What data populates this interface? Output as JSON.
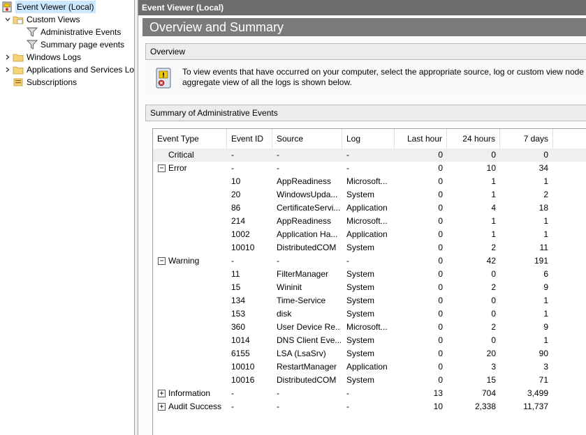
{
  "tree": {
    "root": "Event Viewer (Local)",
    "custom_views": "Custom Views",
    "administrative_events": "Administrative Events",
    "summary_page_events": "Summary page events",
    "windows_logs": "Windows Logs",
    "applications_and_services": "Applications and Services Lo",
    "subscriptions": "Subscriptions"
  },
  "header": {
    "title": "Event Viewer (Local)",
    "page_title": "Overview and Summary"
  },
  "overview": {
    "heading": "Overview",
    "line1": "To view events that have occurred on your computer, select the appropriate source, log or custom view node i",
    "line2": "aggregate view of all the logs is shown below."
  },
  "summary": {
    "heading": "Summary of Administrative Events",
    "columns": [
      "Event Type",
      "Event ID",
      "Source",
      "Log",
      "Last hour",
      "24 hours",
      "7 days"
    ],
    "rows": [
      {
        "type": "Critical",
        "expander": "",
        "id": "-",
        "source": "-",
        "log": "-",
        "hour": "0",
        "day": "0",
        "week": "0",
        "group": true,
        "shaded": true
      },
      {
        "type": "Error",
        "expander": "−",
        "id": "-",
        "source": "-",
        "log": "-",
        "hour": "0",
        "day": "10",
        "week": "34",
        "group": true
      },
      {
        "type": "",
        "expander": "",
        "id": "10",
        "source": "AppReadiness",
        "log": "Microsoft...",
        "hour": "0",
        "day": "1",
        "week": "1"
      },
      {
        "type": "",
        "expander": "",
        "id": "20",
        "source": "WindowsUpda...",
        "log": "System",
        "hour": "0",
        "day": "1",
        "week": "2"
      },
      {
        "type": "",
        "expander": "",
        "id": "86",
        "source": "CertificateServi...",
        "log": "Application",
        "hour": "0",
        "day": "4",
        "week": "18"
      },
      {
        "type": "",
        "expander": "",
        "id": "214",
        "source": "AppReadiness",
        "log": "Microsoft...",
        "hour": "0",
        "day": "1",
        "week": "1"
      },
      {
        "type": "",
        "expander": "",
        "id": "1002",
        "source": "Application Ha...",
        "log": "Application",
        "hour": "0",
        "day": "1",
        "week": "1"
      },
      {
        "type": "",
        "expander": "",
        "id": "10010",
        "source": "DistributedCOM",
        "log": "System",
        "hour": "0",
        "day": "2",
        "week": "11"
      },
      {
        "type": "Warning",
        "expander": "−",
        "id": "-",
        "source": "-",
        "log": "-",
        "hour": "0",
        "day": "42",
        "week": "191",
        "group": true
      },
      {
        "type": "",
        "expander": "",
        "id": "11",
        "source": "FilterManager",
        "log": "System",
        "hour": "0",
        "day": "0",
        "week": "6"
      },
      {
        "type": "",
        "expander": "",
        "id": "15",
        "source": "Wininit",
        "log": "System",
        "hour": "0",
        "day": "2",
        "week": "9"
      },
      {
        "type": "",
        "expander": "",
        "id": "134",
        "source": "Time-Service",
        "log": "System",
        "hour": "0",
        "day": "0",
        "week": "1"
      },
      {
        "type": "",
        "expander": "",
        "id": "153",
        "source": "disk",
        "log": "System",
        "hour": "0",
        "day": "0",
        "week": "1"
      },
      {
        "type": "",
        "expander": "",
        "id": "360",
        "source": "User Device Re...",
        "log": "Microsoft...",
        "hour": "0",
        "day": "2",
        "week": "9"
      },
      {
        "type": "",
        "expander": "",
        "id": "1014",
        "source": "DNS Client Eve...",
        "log": "System",
        "hour": "0",
        "day": "0",
        "week": "1"
      },
      {
        "type": "",
        "expander": "",
        "id": "6155",
        "source": "LSA (LsaSrv)",
        "log": "System",
        "hour": "0",
        "day": "20",
        "week": "90"
      },
      {
        "type": "",
        "expander": "",
        "id": "10010",
        "source": "RestartManager",
        "log": "Application",
        "hour": "0",
        "day": "3",
        "week": "3"
      },
      {
        "type": "",
        "expander": "",
        "id": "10016",
        "source": "DistributedCOM",
        "log": "System",
        "hour": "0",
        "day": "15",
        "week": "71"
      },
      {
        "type": "Information",
        "expander": "+",
        "id": "-",
        "source": "-",
        "log": "-",
        "hour": "13",
        "day": "704",
        "week": "3,499",
        "group": true
      },
      {
        "type": "Audit Success",
        "expander": "+",
        "id": "-",
        "source": "-",
        "log": "-",
        "hour": "10",
        "day": "2,338",
        "week": "11,737",
        "group": true
      }
    ]
  },
  "colors": {
    "header_bg": "#6d6d6d",
    "title_bar_bg": "#7b7b7b",
    "selection": "#cce8ff",
    "section_bg": "#ececec"
  },
  "icons": {
    "root": "event-viewer-icon",
    "folder": "folder-icon",
    "filter": "filter-icon",
    "overview": "log-info-icon"
  }
}
